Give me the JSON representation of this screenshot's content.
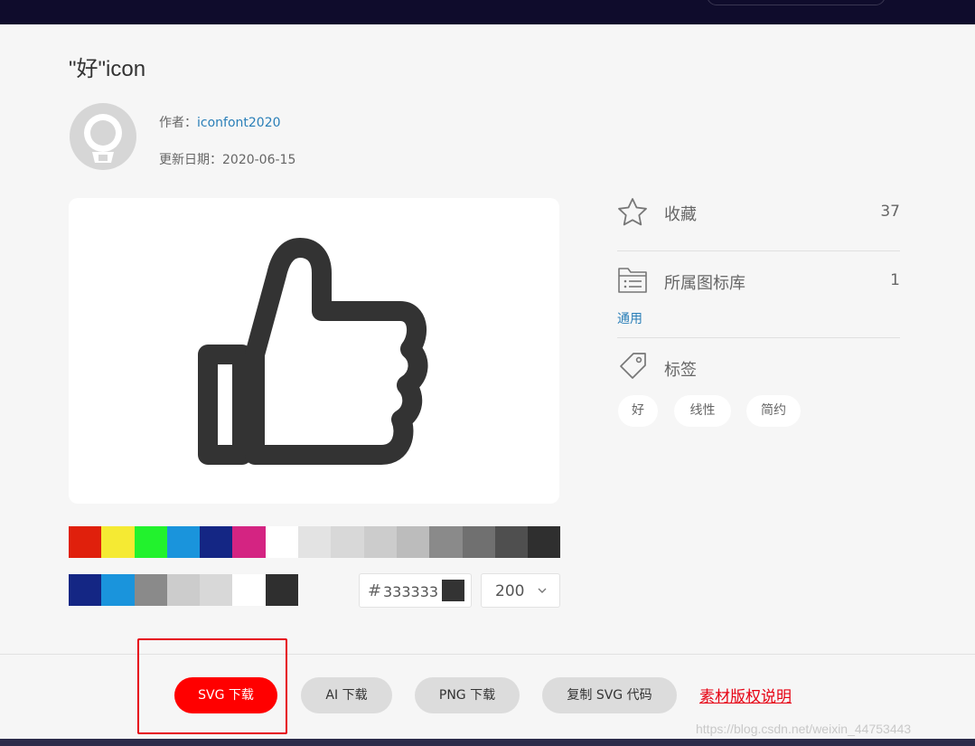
{
  "page": {
    "title": "\"好\"icon",
    "author_label": "作者：",
    "author_name": "iconfont2020",
    "updated_label": "更新日期：",
    "updated_date": "2020-06-15"
  },
  "icon": {
    "name": "thumbs-up-icon",
    "current_color": "#333333"
  },
  "palette": {
    "row1": [
      "#e0200c",
      "#f5ea33",
      "#22f22d",
      "#1a94dc",
      "#142684",
      "#d42482",
      "#ffffff",
      "#e3e3e3",
      "#d8d8d8",
      "#cccccc",
      "#bcbcbc",
      "#8a8a8a",
      "#707070",
      "#4f4f4f",
      "#2f2f2f"
    ],
    "row2": [
      "#142684",
      "#1a94dc",
      "#8a8a8a",
      "#cccccc",
      "#d8d8d8",
      "#ffffff",
      "#2f2f2f"
    ]
  },
  "color_input": {
    "hash": "#",
    "value": "333333"
  },
  "size_select": {
    "value": "200"
  },
  "sidebar": {
    "favorite": {
      "label": "收藏",
      "count": "37",
      "icon": "star-icon"
    },
    "library": {
      "label": "所属图标库",
      "count": "1",
      "link": "通用",
      "icon": "library-icon"
    },
    "tags": {
      "label": "标签",
      "icon": "tag-icon",
      "items": [
        "好",
        "线性",
        "简约"
      ]
    }
  },
  "actions": {
    "svg": "SVG 下载",
    "ai": "AI 下载",
    "png": "PNG 下载",
    "copy_svg": "复制 SVG 代码",
    "license": "素材版权说明"
  },
  "watermark": "https://blog.csdn.net/weixin_44753443",
  "colors": {
    "accent": "#ff0000",
    "link": "#2a7fb8",
    "topbar": "#0f0c2c"
  }
}
